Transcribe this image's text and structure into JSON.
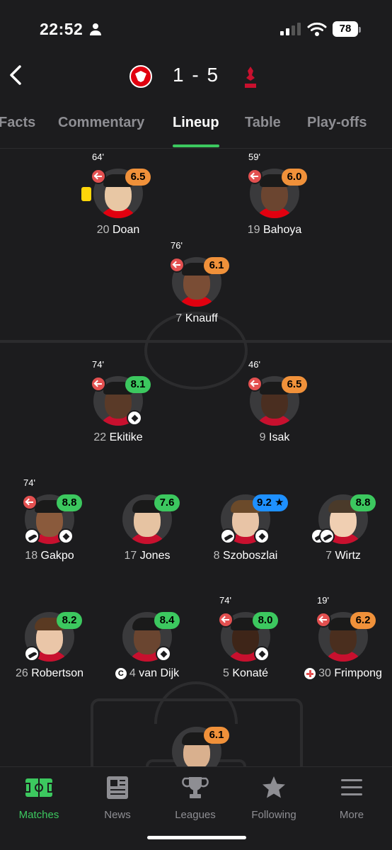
{
  "status": {
    "time": "22:52",
    "battery": "78"
  },
  "header": {
    "score": "1 - 5"
  },
  "tabs": [
    {
      "label": "Facts"
    },
    {
      "label": "Commentary"
    },
    {
      "label": "Lineup"
    },
    {
      "label": "Table"
    },
    {
      "label": "Play-offs"
    }
  ],
  "players": {
    "doan": {
      "minute": "64'",
      "rating": "6.5",
      "num": "20",
      "name": "Doan"
    },
    "bahoya": {
      "minute": "59'",
      "rating": "6.0",
      "num": "19",
      "name": "Bahoya"
    },
    "knauff": {
      "minute": "76'",
      "rating": "6.1",
      "num": "7",
      "name": "Knauff"
    },
    "ekitike": {
      "minute": "74'",
      "rating": "8.1",
      "num": "22",
      "name": "Ekitike"
    },
    "isak": {
      "minute": "46'",
      "rating": "6.5",
      "num": "9",
      "name": "Isak"
    },
    "gakpo": {
      "minute": "74'",
      "rating": "8.8",
      "num": "18",
      "name": "Gakpo"
    },
    "jones": {
      "rating": "7.6",
      "num": "17",
      "name": "Jones"
    },
    "szoboszlai": {
      "rating": "9.2 ★",
      "num": "8",
      "name": "Szoboszlai"
    },
    "wirtz": {
      "rating": "8.8",
      "num": "7",
      "name": "Wirtz"
    },
    "robertson": {
      "rating": "8.2",
      "num": "26",
      "name": "Robertson"
    },
    "vandijk": {
      "rating": "8.4",
      "num": "4",
      "name": "van Dijk",
      "captain": "C"
    },
    "konate": {
      "minute": "74'",
      "rating": "8.0",
      "num": "5",
      "name": "Konaté"
    },
    "frimpong": {
      "minute": "19'",
      "rating": "6.2",
      "num": "30",
      "name": "Frimpong"
    },
    "keeper": {
      "rating": "6.1"
    }
  },
  "tabbar": [
    {
      "label": "Matches",
      "icon": "pitch-icon"
    },
    {
      "label": "News",
      "icon": "newspaper-icon"
    },
    {
      "label": "Leagues",
      "icon": "trophy-icon"
    },
    {
      "label": "Following",
      "icon": "star-icon"
    },
    {
      "label": "More",
      "icon": "menu-icon"
    }
  ],
  "colors": {
    "accent": "#3cc85f",
    "rating_orange": "#f0913a",
    "rating_blue": "#1e90ff",
    "sub": "#e35050"
  }
}
